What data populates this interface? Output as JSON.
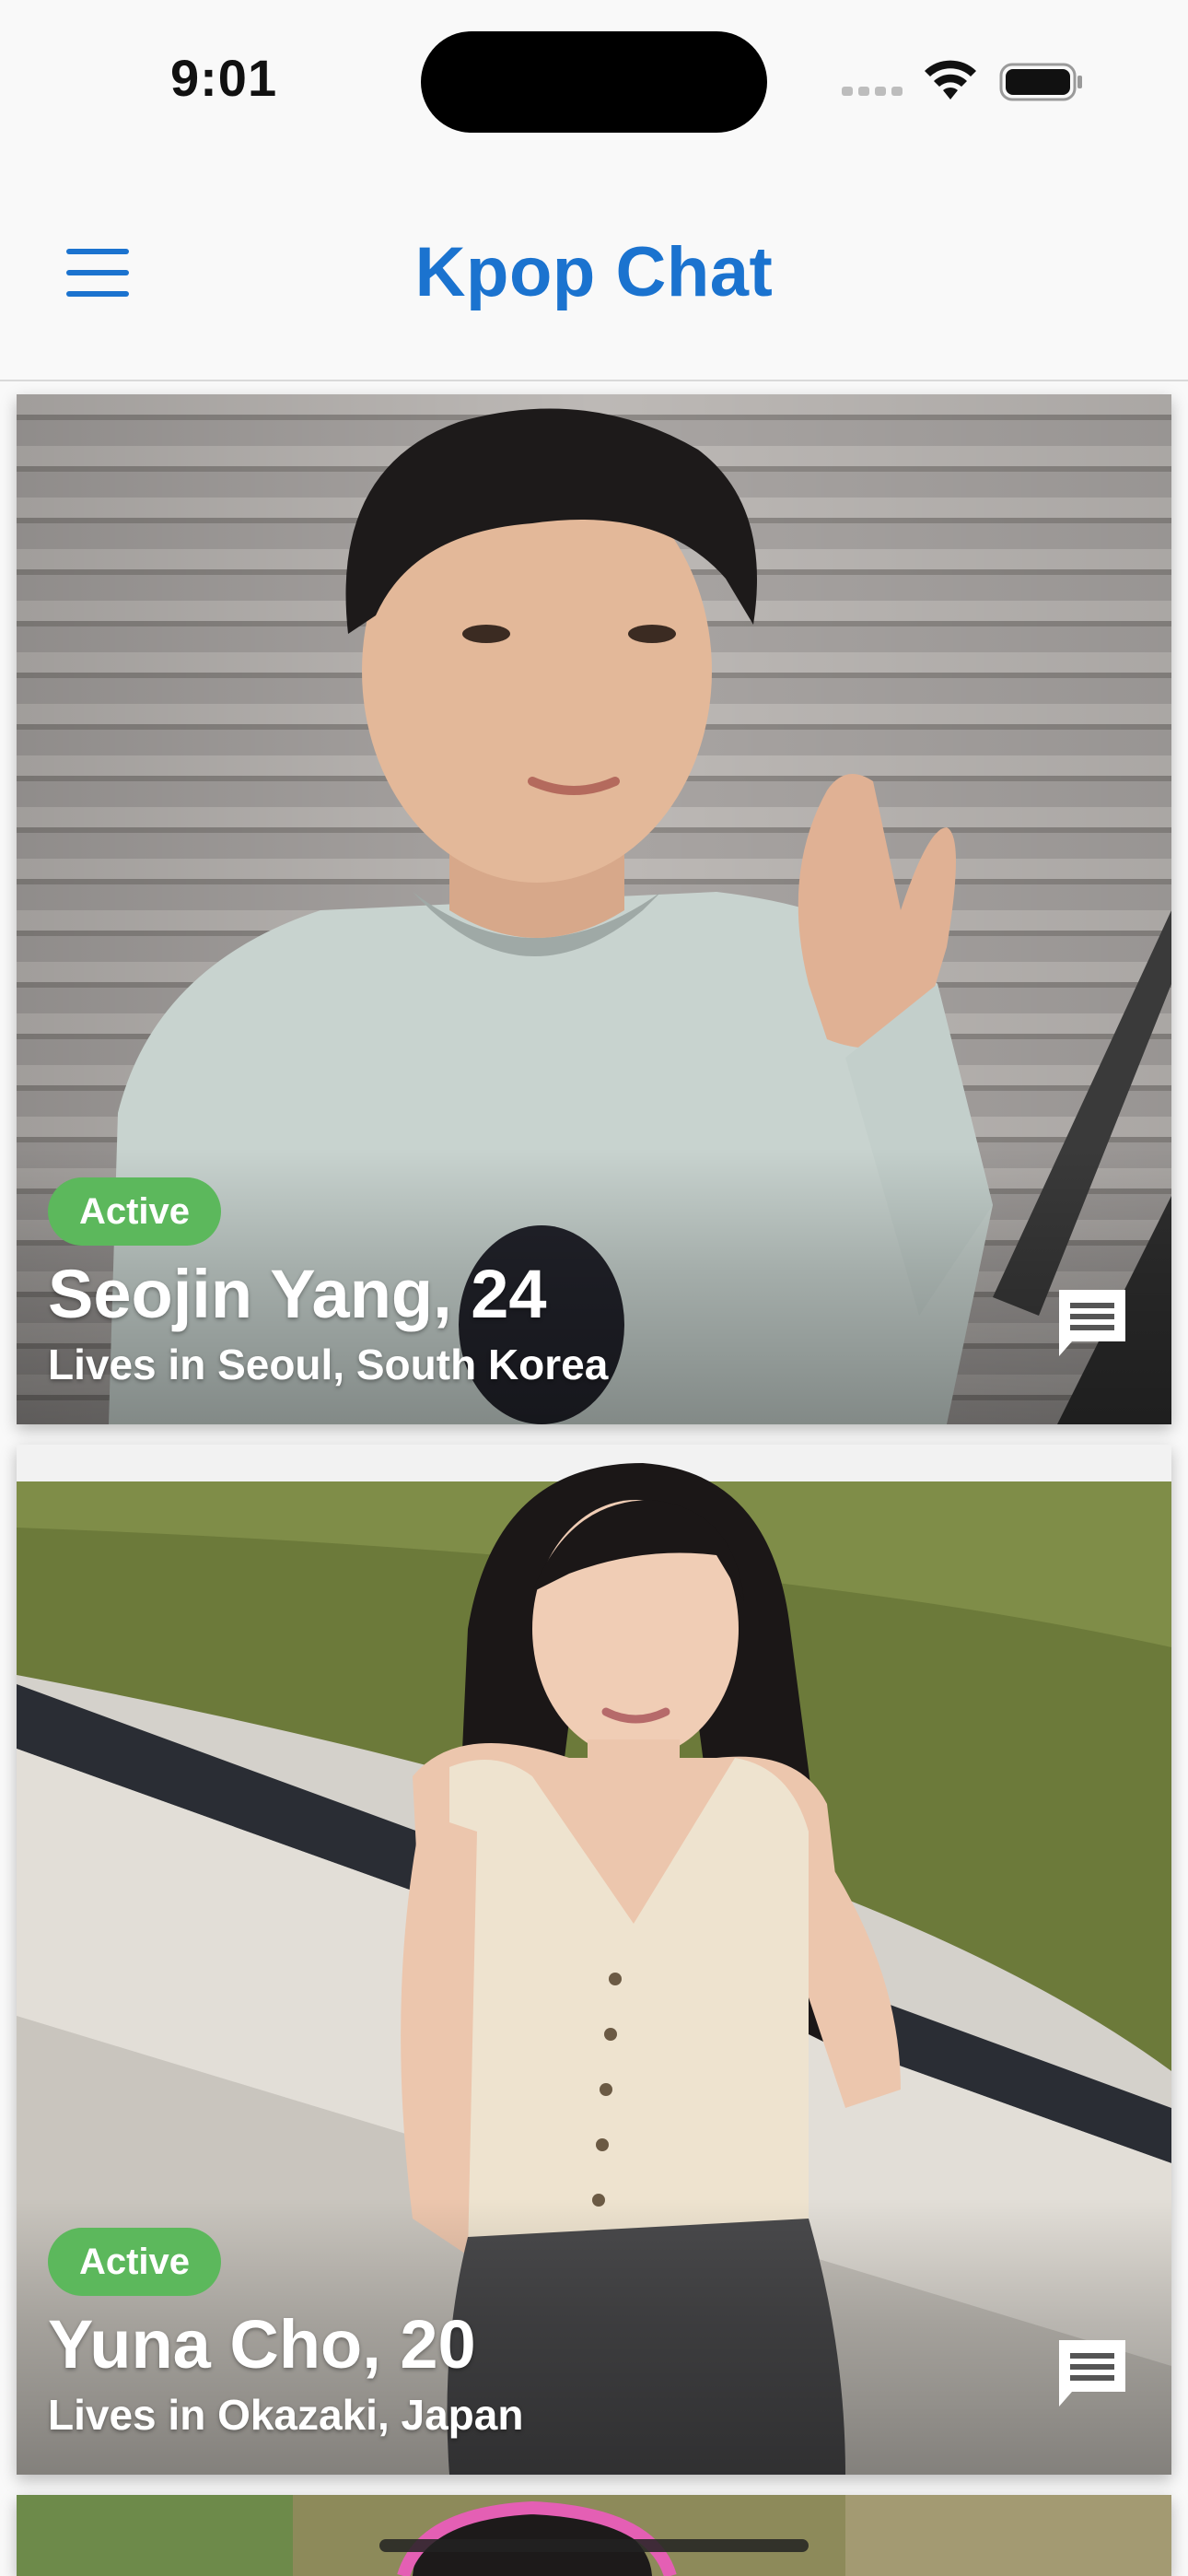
{
  "status_bar": {
    "time": "9:01"
  },
  "header": {
    "title": "Kpop Chat",
    "menu_icon": "hamburger-menu-icon",
    "accent_color": "#1b73cf"
  },
  "profiles": [
    {
      "status": "Active",
      "name_age": "Seojin Yang, 24",
      "location": "Lives in Seoul, South Korea",
      "action_icon": "chat-icon"
    },
    {
      "status": "Active",
      "name_age": "Yuna Cho, 20",
      "location": "Lives in Okazaki, Japan",
      "action_icon": "chat-icon"
    }
  ],
  "colors": {
    "active_badge": "#5cb85c",
    "background": "#f9f9f9"
  }
}
